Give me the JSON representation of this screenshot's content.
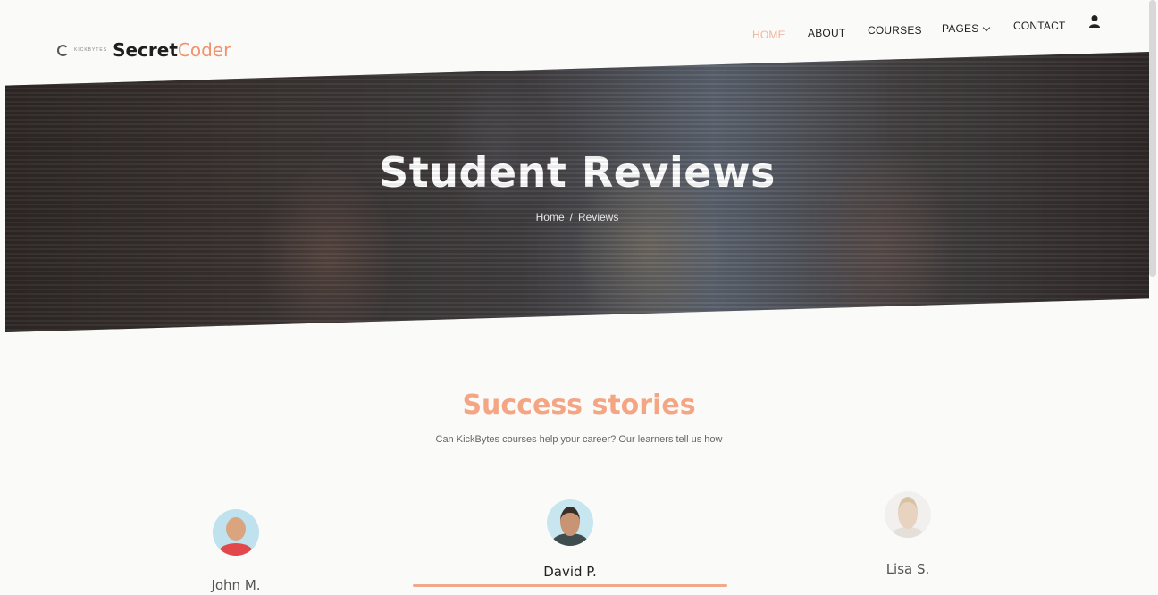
{
  "header": {
    "logo_tagline": "KICKBYTES",
    "logo_primary": "Secret",
    "logo_accent": "Coder",
    "nav": [
      {
        "label": "Home",
        "active": true
      },
      {
        "label": "About",
        "active": false
      },
      {
        "label": "Courses",
        "active": false
      },
      {
        "label": "Pages",
        "active": false,
        "has_dropdown": true
      },
      {
        "label": "Contact",
        "active": false
      }
    ],
    "user_icon": "user-icon"
  },
  "hero": {
    "title": "Student Reviews",
    "breadcrumb": {
      "home": "Home",
      "separator": "/",
      "current": "Reviews"
    }
  },
  "section": {
    "title": "Success stories",
    "subtitle": "Can KickBytes courses help your career? Our learners tell us how"
  },
  "reviewers": [
    {
      "name": "John M.",
      "active": false
    },
    {
      "name": "David P.",
      "active": true
    },
    {
      "name": "Lisa S.",
      "active": false
    }
  ],
  "colors": {
    "accent": "#f0936e",
    "nav_active": "#f3b49c",
    "section_title": "#f3a584",
    "underline": "#f0a98c"
  }
}
